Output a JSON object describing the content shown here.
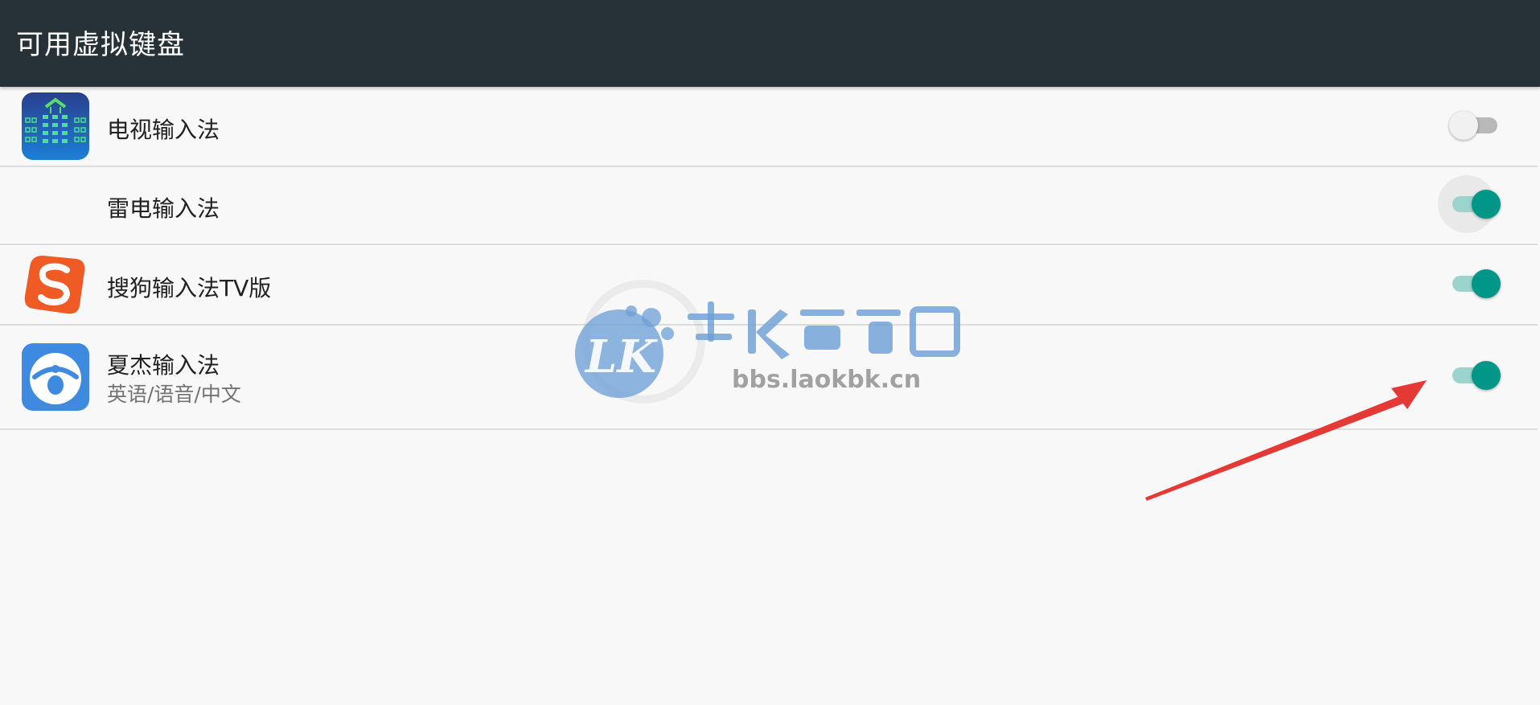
{
  "appbar": {
    "title": "可用虚拟键盘"
  },
  "keyboards": [
    {
      "name": "电视输入法",
      "subtitle": "",
      "icon": "tv-keyboard-icon",
      "enabled": false
    },
    {
      "name": "雷电输入法",
      "subtitle": "",
      "icon": "",
      "enabled": true
    },
    {
      "name": "搜狗输入法TV版",
      "subtitle": "",
      "icon": "sogou-icon",
      "enabled": true
    },
    {
      "name": "夏杰输入法",
      "subtitle": "英语/语音/中文",
      "icon": "xiajie-icon",
      "enabled": true
    }
  ],
  "watermark": {
    "url": "bbs.laokbk.cn"
  },
  "colors": {
    "appbar": "#263238",
    "accent": "#009688",
    "accent_track": "#9cd3cc",
    "annotation_arrow": "#e53935"
  }
}
